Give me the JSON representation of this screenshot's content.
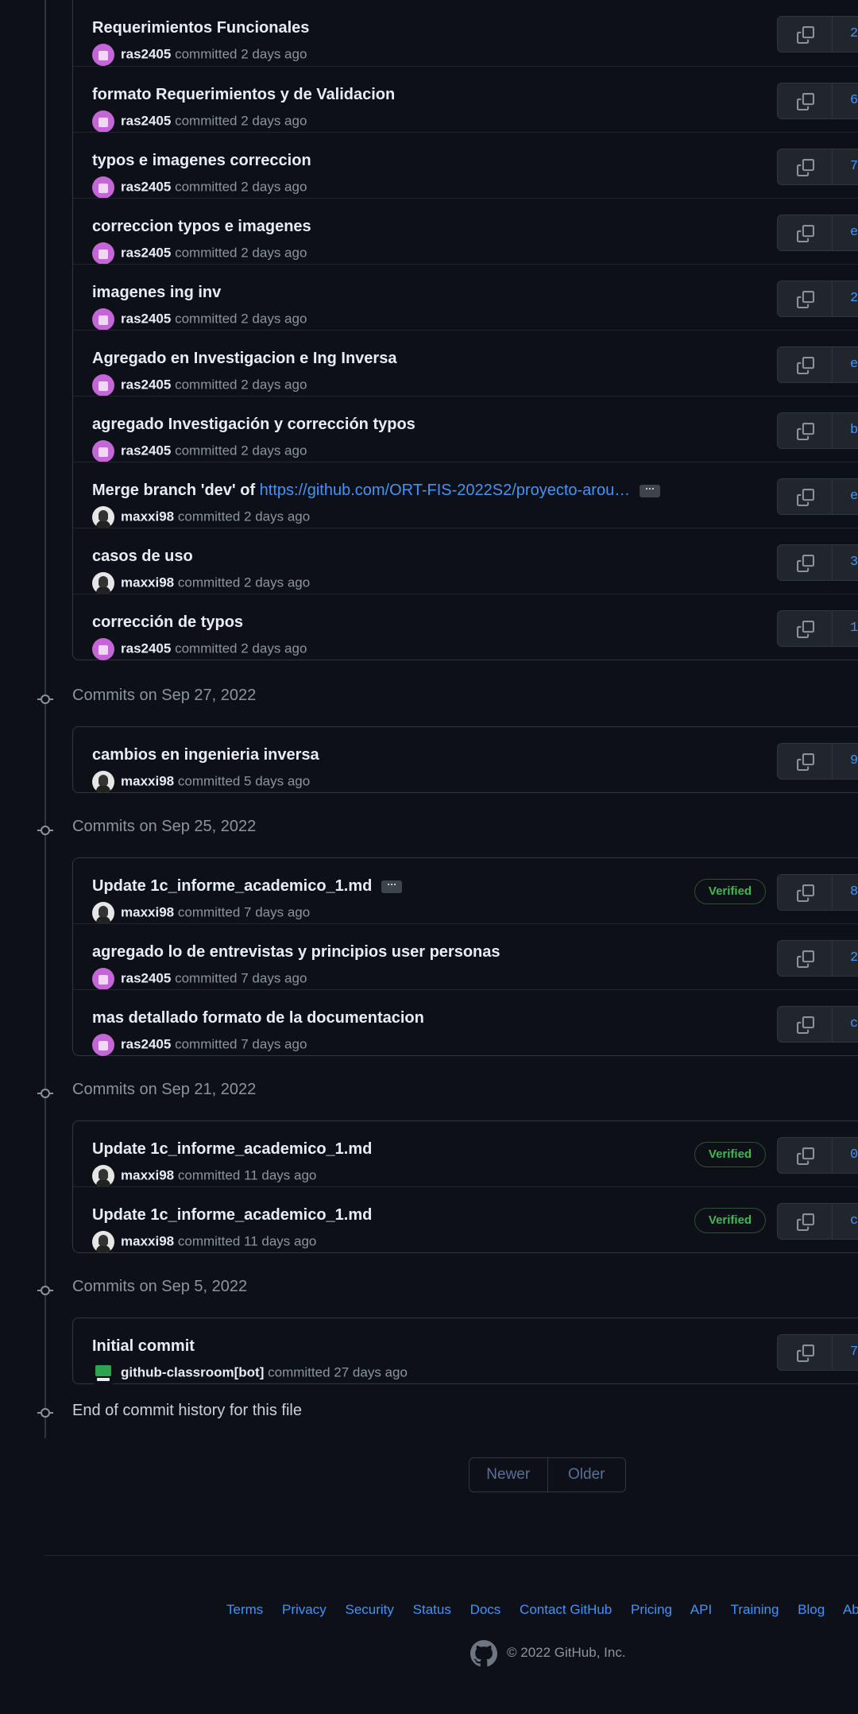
{
  "groups": [
    {
      "date": "",
      "commits": [
        {
          "title": "Requerimientos Funcionales",
          "author": "ras2405",
          "avatar": "purple",
          "action": "committed",
          "when": "2 days ago",
          "verified": false,
          "sha": "2"
        },
        {
          "title": "formato Requerimientos y de Validacion",
          "author": "ras2405",
          "avatar": "purple",
          "action": "committed",
          "when": "2 days ago",
          "verified": false,
          "sha": "6"
        },
        {
          "title": "typos e imagenes correccion",
          "author": "ras2405",
          "avatar": "purple",
          "action": "committed",
          "when": "2 days ago",
          "verified": false,
          "sha": "7"
        },
        {
          "title": "correccion typos e imagenes",
          "author": "ras2405",
          "avatar": "purple",
          "action": "committed",
          "when": "2 days ago",
          "verified": false,
          "sha": "e"
        },
        {
          "title": "imagenes ing inv",
          "author": "ras2405",
          "avatar": "purple",
          "action": "committed",
          "when": "2 days ago",
          "verified": false,
          "sha": "2"
        },
        {
          "title": "Agregado en Investigacion e Ing Inversa",
          "author": "ras2405",
          "avatar": "purple",
          "action": "committed",
          "when": "2 days ago",
          "verified": false,
          "sha": "e"
        },
        {
          "title": "agregado Investigación y corrección typos",
          "author": "ras2405",
          "avatar": "purple",
          "action": "committed",
          "when": "2 days ago",
          "verified": false,
          "sha": "b"
        },
        {
          "title": "Merge branch 'dev' of ",
          "link": "https://github.com/ORT-FIS-2022S2/proyecto-arou…",
          "ellipsis": "···",
          "author": "maxxi98",
          "avatar": "photo",
          "action": "committed",
          "when": "2 days ago",
          "verified": false,
          "sha": "e"
        },
        {
          "title": "casos de uso",
          "author": "maxxi98",
          "avatar": "photo",
          "action": "committed",
          "when": "2 days ago",
          "verified": false,
          "sha": "3"
        },
        {
          "title": "corrección de typos",
          "author": "ras2405",
          "avatar": "purple",
          "action": "committed",
          "when": "2 days ago",
          "verified": false,
          "sha": "1"
        }
      ]
    },
    {
      "date": "Commits on Sep 27, 2022",
      "commits": [
        {
          "title": "cambios en ingenieria inversa",
          "author": "maxxi98",
          "avatar": "photo",
          "action": "committed",
          "when": "5 days ago",
          "verified": false,
          "sha": "9"
        }
      ]
    },
    {
      "date": "Commits on Sep 25, 2022",
      "commits": [
        {
          "title": "Update 1c_informe_academico_1.md",
          "ellipsis": "···",
          "author": "maxxi98",
          "avatar": "photo",
          "action": "committed",
          "when": "7 days ago",
          "verified": true,
          "sha": "8"
        },
        {
          "title": "agregado lo de entrevistas y principios user personas",
          "author": "ras2405",
          "avatar": "purple",
          "action": "committed",
          "when": "7 days ago",
          "verified": false,
          "sha": "2"
        },
        {
          "title": "mas detallado formato de la documentacion",
          "author": "ras2405",
          "avatar": "purple",
          "action": "committed",
          "when": "7 days ago",
          "verified": false,
          "sha": "c"
        }
      ]
    },
    {
      "date": "Commits on Sep 21, 2022",
      "commits": [
        {
          "title": "Update 1c_informe_academico_1.md",
          "author": "maxxi98",
          "avatar": "photo",
          "action": "committed",
          "when": "11 days ago",
          "verified": true,
          "sha": "0"
        },
        {
          "title": "Update 1c_informe_academico_1.md",
          "author": "maxxi98",
          "avatar": "photo",
          "action": "committed",
          "when": "11 days ago",
          "verified": true,
          "sha": "c"
        }
      ]
    },
    {
      "date": "Commits on Sep 5, 2022",
      "commits": [
        {
          "title": "Initial commit",
          "author": "github-classroom[bot]",
          "avatar": "bot",
          "action": "committed",
          "when": "27 days ago",
          "verified": false,
          "sha": "7"
        }
      ]
    }
  ],
  "verified_label": "Verified",
  "end_text": "End of commit history for this file",
  "pagination": {
    "newer": "Newer",
    "older": "Older"
  },
  "footer": {
    "links": [
      "Terms",
      "Privacy",
      "Security",
      "Status",
      "Docs",
      "Contact GitHub",
      "Pricing",
      "API",
      "Training",
      "Blog",
      "About"
    ],
    "copyright": "© 2022 GitHub, Inc."
  },
  "colors": {
    "link": "#4493f8",
    "verified": "#3fb950",
    "background": "#0d1117"
  }
}
